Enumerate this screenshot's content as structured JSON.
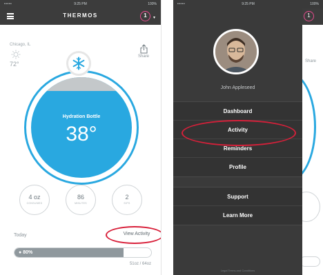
{
  "left_phone": {
    "status": {
      "signal": "•••••",
      "time": "9:25 PM",
      "battery": "100%"
    },
    "header": {
      "logo": "THERMOS",
      "notification_count": "1"
    },
    "weather": {
      "city": "Chicago, IL",
      "temp": "72°"
    },
    "share_label": "Share",
    "bottle": {
      "label": "Hydration Bottle",
      "temperature": "38°",
      "fill_fraction": 0.86
    },
    "stats": [
      {
        "value": "4 oz",
        "unit": "CONSUMED"
      },
      {
        "value": "86",
        "unit": "MINUTES"
      },
      {
        "value": "2",
        "unit": "SIPS"
      }
    ],
    "today": {
      "label": "Today",
      "view_activity": "View Activity",
      "progress_percent": 80,
      "progress_text": "80%",
      "amount": "51oz / 64oz"
    }
  },
  "right_phone": {
    "status": {
      "signal": "•••••",
      "time": "9:25 PM",
      "battery": "100%"
    },
    "user": {
      "name": "John Appleseed"
    },
    "menu_primary": [
      "Dashboard",
      "Activity",
      "Reminders",
      "Profile"
    ],
    "menu_secondary": [
      "Support",
      "Learn More"
    ],
    "footer": "Legal Terms and Conditions",
    "peek": {
      "notification_count": "1",
      "share_label": "Share"
    }
  },
  "colors": {
    "accent_blue": "#29a8e0",
    "highlight_red": "#d8203a",
    "badge_pink": "#e94b8f",
    "drawer_bg": "#3a3a3a"
  }
}
